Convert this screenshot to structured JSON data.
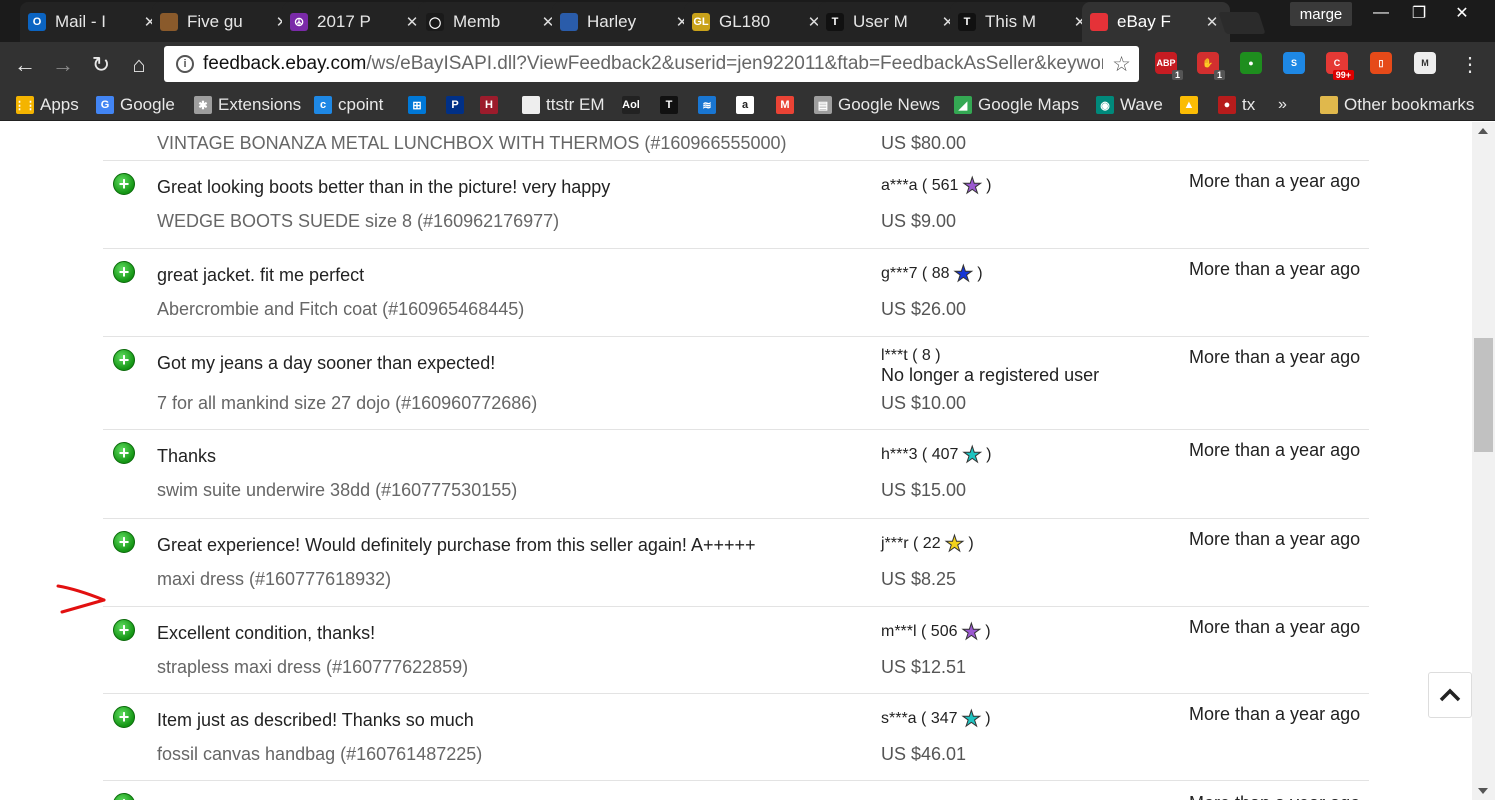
{
  "browser": {
    "tabs": [
      {
        "title": "Mail - I",
        "icon": "outlook-icon",
        "color": "#0b64c2",
        "glyph": "O"
      },
      {
        "title": "Five gu",
        "icon": "picture-icon",
        "color": "#8a5a2b",
        "glyph": ""
      },
      {
        "title": "2017 P",
        "icon": "peace-icon",
        "color": "#7a2aa8",
        "glyph": "☮"
      },
      {
        "title": "Memb",
        "icon": "circle-logo-icon",
        "color": "#1a1a1a",
        "glyph": "◯"
      },
      {
        "title": "Harley",
        "icon": "mountain-icon",
        "color": "#2a5caa",
        "glyph": ""
      },
      {
        "title": "GL180",
        "icon": "gl-icon",
        "color": "#c9a21a",
        "glyph": "GL"
      },
      {
        "title": "User M",
        "icon": "t-logo-icon",
        "color": "#111111",
        "glyph": "T"
      },
      {
        "title": "This M",
        "icon": "t-logo-icon",
        "color": "#111111",
        "glyph": "T"
      },
      {
        "title": "eBay F",
        "icon": "ebay-bag-icon",
        "color": "#e53238",
        "glyph": ""
      }
    ],
    "profile_name": "marge",
    "url_host": "feedback.ebay.com",
    "url_path": "/ws/eBayISAPI.dll?ViewFeedback2&userid=jen922011&ftab=FeedbackAsSeller&keyword",
    "extensions": [
      {
        "name": "adblock-icon",
        "label": "ABP",
        "color": "#c71c22",
        "badge": "1"
      },
      {
        "name": "hand-icon",
        "label": "✋",
        "color": "#d32f2f",
        "badge": "1"
      },
      {
        "name": "green-dot-icon",
        "label": "●",
        "color": "#1e8e1e",
        "badge": ""
      },
      {
        "name": "s-icon",
        "label": "S",
        "color": "#1e88e5",
        "badge": ""
      },
      {
        "name": "c-icon",
        "label": "C",
        "color": "#e53935",
        "badge": "99+"
      },
      {
        "name": "office-icon",
        "label": "▯",
        "color": "#e64a19",
        "badge": ""
      },
      {
        "name": "shield-m-icon",
        "label": "M",
        "color": "#eeeeee",
        "badge": ""
      }
    ],
    "bookmarks": [
      {
        "label": "Apps",
        "icon": "apps-grid-icon",
        "color": "#f4b400",
        "glyph": "⋮⋮"
      },
      {
        "label": "Google",
        "icon": "google-icon",
        "color": "#4285f4",
        "glyph": "G"
      },
      {
        "label": "Extensions",
        "icon": "puzzle-icon",
        "color": "#9e9e9e",
        "glyph": "✱"
      },
      {
        "label": "cpoint",
        "icon": "cpoint-icon",
        "color": "#1e88e5",
        "glyph": "c"
      },
      {
        "label": "",
        "icon": "windows-icon",
        "color": "#0078d7",
        "glyph": "⊞"
      },
      {
        "label": "",
        "icon": "paypal-icon",
        "color": "#003087",
        "glyph": "P"
      },
      {
        "label": "",
        "icon": "h-logo-icon",
        "color": "#9c1c2c",
        "glyph": "H"
      },
      {
        "label": "ttstr EM",
        "icon": "page-icon",
        "color": "#eeeeee",
        "glyph": ""
      },
      {
        "label": "",
        "icon": "aol-icon",
        "color": "#222222",
        "glyph": "Aol"
      },
      {
        "label": "",
        "icon": "t-logo-icon",
        "color": "#111111",
        "glyph": "T"
      },
      {
        "label": "",
        "icon": "envelope-icon",
        "color": "#1976d2",
        "glyph": "≋"
      },
      {
        "label": "",
        "icon": "amazon-icon",
        "color": "#ffffff",
        "glyph": "a"
      },
      {
        "label": "",
        "icon": "gmail-icon",
        "color": "#ea4335",
        "glyph": "M"
      },
      {
        "label": "Google News",
        "icon": "news-icon",
        "color": "#9e9e9e",
        "glyph": "▤"
      },
      {
        "label": "Google Maps",
        "icon": "maps-icon",
        "color": "#34a853",
        "glyph": "◢"
      },
      {
        "label": "Wave",
        "icon": "wave-icon",
        "color": "#00897b",
        "glyph": "◉"
      },
      {
        "label": "",
        "icon": "drive-icon",
        "color": "#fbbc04",
        "glyph": "▲"
      },
      {
        "label": "tx",
        "icon": "tx-icon",
        "color": "#b71c1c",
        "glyph": "●"
      }
    ],
    "bookmarks_overflow": "»",
    "other_bookmarks": "Other bookmarks"
  },
  "feedback": [
    {
      "comment": "",
      "item": "VINTAGE BONANZA METAL LUNCHBOX WITH THERMOS (#160966555000)",
      "user": "",
      "score": "",
      "star_color": "",
      "note": "",
      "price": "US $80.00",
      "time": ""
    },
    {
      "comment": "Great looking boots better than in the picture! very happy",
      "item": "WEDGE BOOTS SUEDE size 8 (#160962176977)",
      "user": "a***a (",
      "score": "561",
      "star_color": "#9b59d0",
      "note": "",
      "price": "US $9.00",
      "time": "More than a year ago"
    },
    {
      "comment": "great jacket. fit me perfect",
      "item": "Abercrombie and Fitch coat (#160965468445)",
      "user": "g***7 (",
      "score": "88",
      "star_color": "#1535d6",
      "note": "",
      "price": "US $26.00",
      "time": "More than a year ago"
    },
    {
      "comment": "Got my jeans a day sooner than expected!",
      "item": "7 for all mankind size 27 dojo (#160960772686)",
      "user": "l***t (",
      "score": "8 )",
      "star_color": "",
      "note": "No longer a registered user",
      "price": "US $10.00",
      "time": "More than a year ago"
    },
    {
      "comment": "Thanks",
      "item": "swim suite underwire 38dd (#160777530155)",
      "user": "h***3 (",
      "score": "407",
      "star_color": "#1ec3c0",
      "note": "",
      "price": "US $15.00",
      "time": "More than a year ago"
    },
    {
      "comment": "Great experience! Would definitely purchase from this seller again! A+++++",
      "item": "maxi dress (#160777618932)",
      "user": "j***r (",
      "score": "22",
      "star_color": "#f2d21b",
      "note": "",
      "price": "US $8.25",
      "time": "More than a year ago"
    },
    {
      "comment": "Excellent condition, thanks!",
      "item": "strapless maxi dress (#160777622859)",
      "user": "m***l (",
      "score": "506",
      "star_color": "#9b59d0",
      "note": "",
      "price": "US $12.51",
      "time": "More than a year ago"
    },
    {
      "comment": "Item just as described! Thanks so much",
      "item": "fossil canvas handbag (#160761487225)",
      "user": "s***a (",
      "score": "347",
      "star_color": "#1ec3c0",
      "note": "",
      "price": "US $46.01",
      "time": "More than a year ago"
    },
    {
      "comment": "",
      "item": "",
      "user": "",
      "score": "",
      "star_color": "",
      "note": "",
      "price": "",
      "time": "More than a year ago"
    }
  ]
}
